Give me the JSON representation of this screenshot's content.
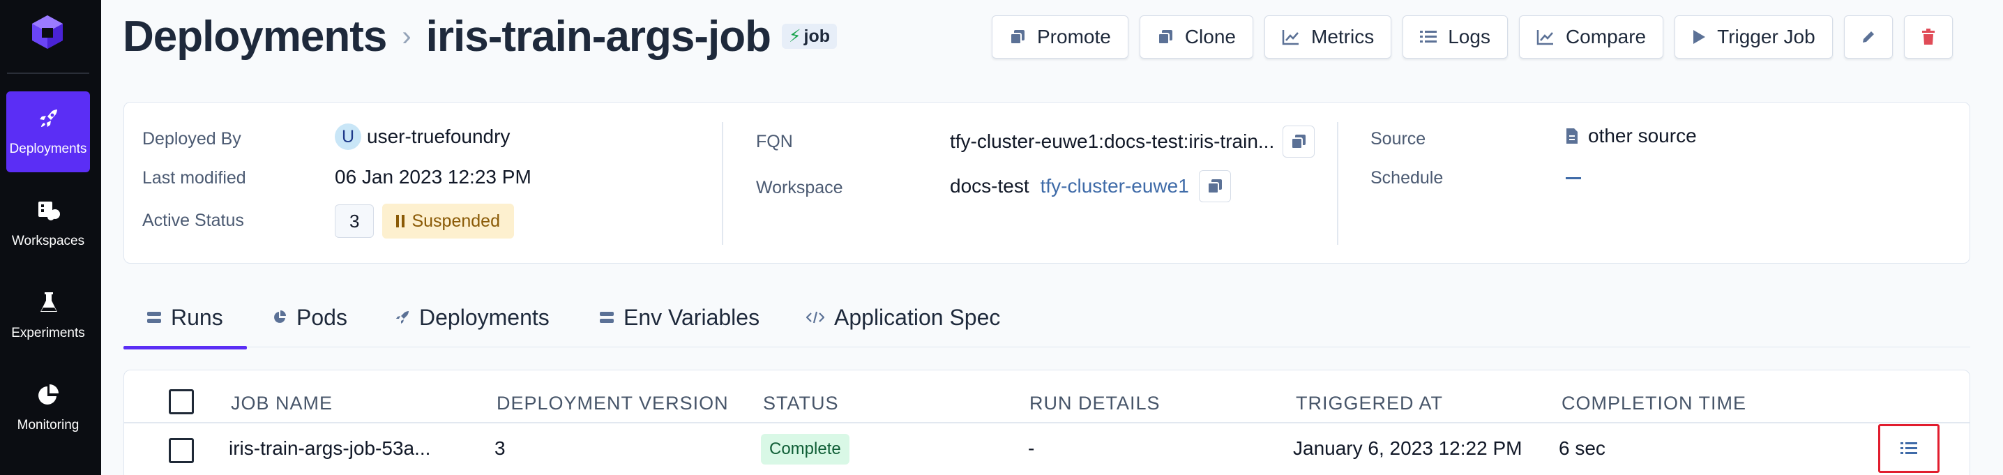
{
  "sidebar": {
    "items": [
      {
        "label": "Deployments",
        "icon": "rocket-icon",
        "active": true
      },
      {
        "label": "Workspaces",
        "icon": "workspaces-icon",
        "active": false
      },
      {
        "label": "Experiments",
        "icon": "flask-icon",
        "active": false
      },
      {
        "label": "Monitoring",
        "icon": "pie-chart-icon",
        "active": false
      }
    ]
  },
  "header": {
    "section": "Deployments",
    "name": "iris-train-args-job",
    "badge": "job"
  },
  "toolbar": {
    "promote": "Promote",
    "clone": "Clone",
    "metrics": "Metrics",
    "logs": "Logs",
    "compare": "Compare",
    "trigger": "Trigger Job"
  },
  "info": {
    "deployed_by_label": "Deployed By",
    "deployed_by_initial": "U",
    "deployed_by": "user-truefoundry",
    "last_modified_label": "Last modified",
    "last_modified": "06 Jan 2023 12:23 PM",
    "active_status_label": "Active Status",
    "active_count": "3",
    "status": "Suspended",
    "fqn_label": "FQN",
    "fqn": "tfy-cluster-euwe1:docs-test:iris-train...",
    "workspace_label": "Workspace",
    "workspace": "docs-test",
    "cluster": "tfy-cluster-euwe1",
    "source_label": "Source",
    "source": "other source",
    "schedule_label": "Schedule"
  },
  "tabs": [
    {
      "label": "Runs",
      "active": true
    },
    {
      "label": "Pods",
      "active": false
    },
    {
      "label": "Deployments",
      "active": false
    },
    {
      "label": "Env Variables",
      "active": false
    },
    {
      "label": "Application Spec",
      "active": false
    }
  ],
  "table": {
    "columns": [
      "JOB NAME",
      "DEPLOYMENT VERSION",
      "STATUS",
      "RUN DETAILS",
      "TRIGGERED AT",
      "COMPLETION TIME"
    ],
    "rows": [
      {
        "job_name": "iris-train-args-job-53a...",
        "version": "3",
        "status": "Complete",
        "run_details": "-",
        "triggered_at": "January 6, 2023 12:22 PM",
        "completion_time": "6 sec"
      }
    ]
  },
  "colors": {
    "accent": "#5b2ef5",
    "sidebar_bg": "#0b0d12",
    "suspended_bg": "#fdf0cf",
    "complete_bg": "#d9f8e6",
    "highlight": "#e11d2e"
  }
}
